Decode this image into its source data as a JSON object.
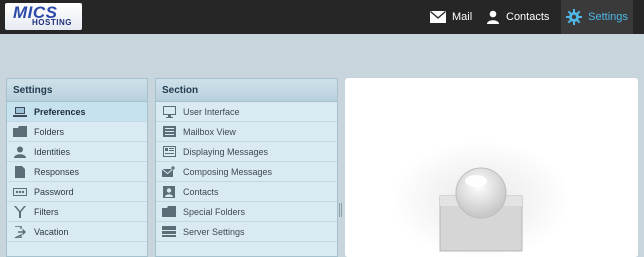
{
  "brand": {
    "name": "MICS",
    "sub": "HOSTING"
  },
  "topnav": [
    {
      "label": "Mail",
      "icon": "mail-icon"
    },
    {
      "label": "Contacts",
      "icon": "contacts-icon"
    },
    {
      "label": "Settings",
      "icon": "gear-icon",
      "active": true
    }
  ],
  "settings": {
    "title": "Settings",
    "items": [
      {
        "label": "Preferences",
        "icon": "preferences-icon",
        "selected": true
      },
      {
        "label": "Folders",
        "icon": "folder-icon"
      },
      {
        "label": "Identities",
        "icon": "identity-icon"
      },
      {
        "label": "Responses",
        "icon": "document-icon"
      },
      {
        "label": "Password",
        "icon": "password-icon"
      },
      {
        "label": "Filters",
        "icon": "filter-icon"
      },
      {
        "label": "Vacation",
        "icon": "vacation-icon"
      }
    ]
  },
  "section": {
    "title": "Section",
    "items": [
      {
        "label": "User Interface",
        "icon": "monitor-icon"
      },
      {
        "label": "Mailbox View",
        "icon": "mailbox-icon"
      },
      {
        "label": "Displaying Messages",
        "icon": "display-messages-icon"
      },
      {
        "label": "Composing Messages",
        "icon": "compose-icon"
      },
      {
        "label": "Contacts",
        "icon": "contact-card-icon"
      },
      {
        "label": "Special Folders",
        "icon": "special-folder-icon"
      },
      {
        "label": "Server Settings",
        "icon": "server-icon"
      }
    ]
  },
  "colors": {
    "accent": "#4fb8e8",
    "topbar": "#262626",
    "panel": "#daeaf2"
  }
}
